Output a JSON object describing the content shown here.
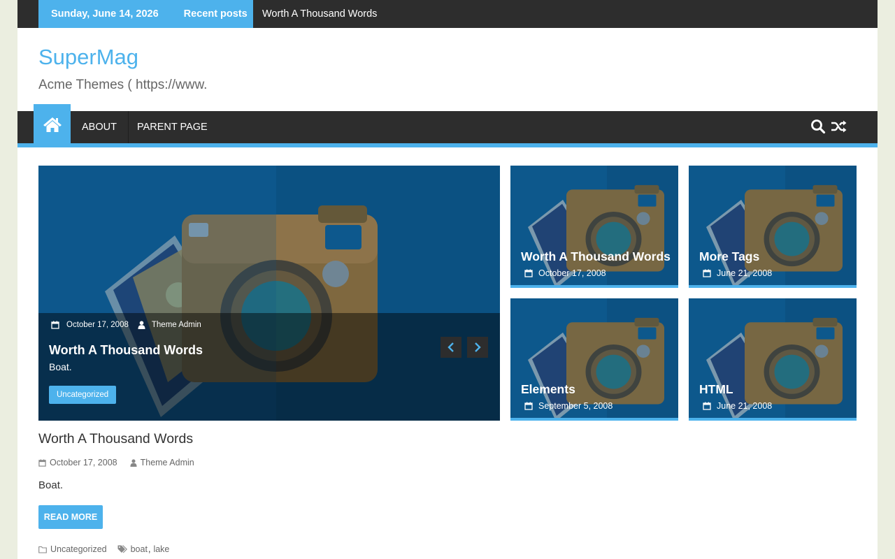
{
  "topbar": {
    "date": "Sunday, June 14, 2026",
    "recent_label": "Recent posts",
    "ticker": "Worth A Thousand Words"
  },
  "header": {
    "site_title": "SuperMag",
    "site_description": "Acme Themes ( https://www."
  },
  "nav": {
    "items": [
      {
        "label": "ABOUT"
      },
      {
        "label": "PARENT PAGE"
      }
    ],
    "icons": [
      "home-icon",
      "search-icon",
      "random-icon"
    ]
  },
  "slider": {
    "date": "October 17, 2008",
    "author": "Theme Admin",
    "title": "Worth A Thousand Words",
    "excerpt": "Boat.",
    "category": "Uncategorized"
  },
  "tiles": [
    {
      "title": "Worth A Thousand Words",
      "date": "October 17, 2008"
    },
    {
      "title": "More Tags",
      "date": "June 21, 2008"
    },
    {
      "title": "Elements",
      "date": "September 5, 2008"
    },
    {
      "title": "HTML",
      "date": "June 21, 2008"
    }
  ],
  "article": {
    "title": "Worth A Thousand Words",
    "date": "October 17, 2008",
    "author": "Theme Admin",
    "excerpt": "Boat.",
    "read_more": "READ MORE",
    "category": "Uncategorized",
    "tags": [
      "boat",
      "lake"
    ]
  },
  "colors": {
    "accent": "#4db2ec",
    "dark": "#2d2d2d",
    "image_bg": "#0d5588"
  }
}
